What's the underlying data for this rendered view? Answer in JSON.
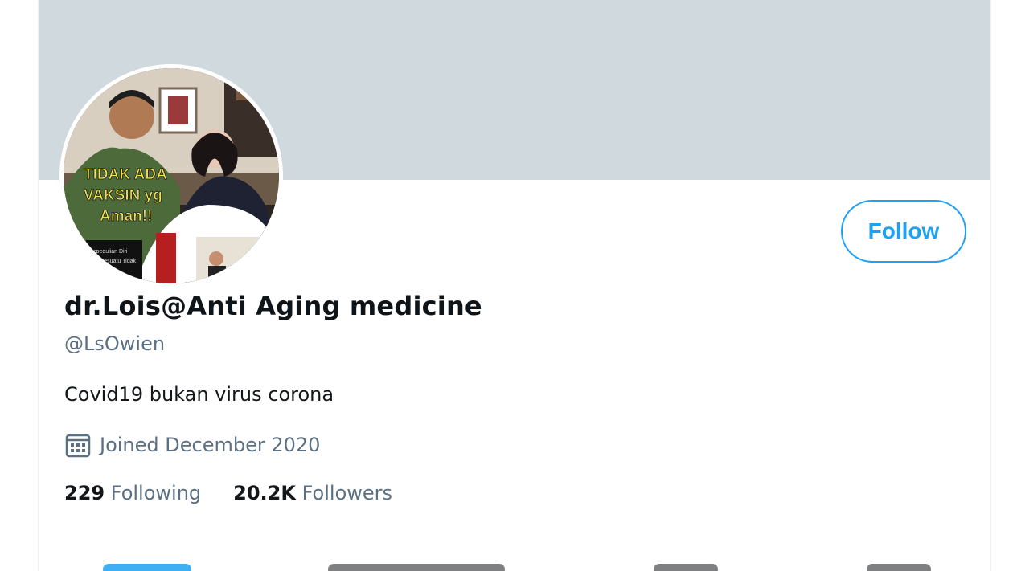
{
  "profile": {
    "display_name": "dr.Lois@Anti Aging medicine",
    "handle": "@LsOwien",
    "bio": "Covid19 bukan virus corona",
    "joined": "Joined December 2020",
    "following_count": "229",
    "following_label": "Following",
    "followers_count": "20.2K",
    "followers_label": "Followers"
  },
  "actions": {
    "follow_label": "Follow"
  },
  "avatar": {
    "overlay_lines": [
      "TIDAK ADA",
      "VAKSIN yg",
      "Aman!!"
    ]
  },
  "icons": {
    "joined": "calendar-icon"
  },
  "colors": {
    "accent": "#1da1f2",
    "banner": "#cfd9de",
    "secondary_text": "#5b7083",
    "primary_text": "#14171a"
  }
}
